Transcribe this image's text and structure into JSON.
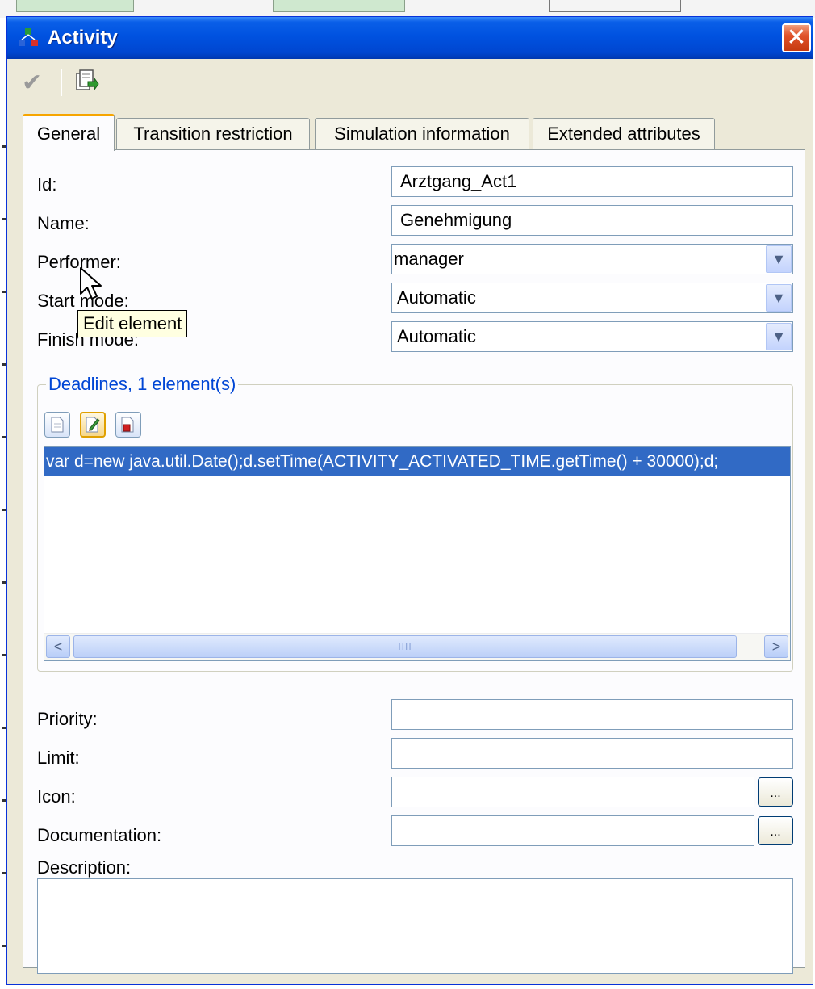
{
  "window": {
    "title": "Activity",
    "close_glyph": "✕"
  },
  "icons": {
    "title": "activity-icon",
    "confirm": "check-icon",
    "export": "export-icon"
  },
  "tabs": [
    {
      "label": "General",
      "active": true
    },
    {
      "label": "Transition restriction",
      "active": false
    },
    {
      "label": "Simulation information",
      "active": false
    },
    {
      "label": "Extended attributes",
      "active": false
    }
  ],
  "form": {
    "id_label": "Id:",
    "id_value": "Arztgang_Act1",
    "name_label": "Name:",
    "name_value": "Genehmigung",
    "performer_label": "Performer:",
    "performer_value": "manager",
    "start_mode_label": "Start mode:",
    "start_mode_value": "Automatic",
    "finish_mode_label": "Finish mode:",
    "finish_mode_value": "Automatic",
    "priority_label": "Priority:",
    "priority_value": "",
    "limit_label": "Limit:",
    "limit_value": "",
    "icon_label": "Icon:",
    "icon_value": "",
    "documentation_label": "Documentation:",
    "documentation_value": "",
    "description_label": "Description:",
    "browse_label": "...",
    "dropdown_glyph": "▼"
  },
  "deadlines": {
    "title": "Deadlines, 1 element(s)",
    "rows": [
      "var d=new java.util.Date();d.setTime(ACTIVITY_ACTIVATED_TIME.getTime() + 30000);d;"
    ],
    "tooltip": "Edit element",
    "scroll_left": "<",
    "scroll_right": ">",
    "scroll_grip": "IIII"
  }
}
